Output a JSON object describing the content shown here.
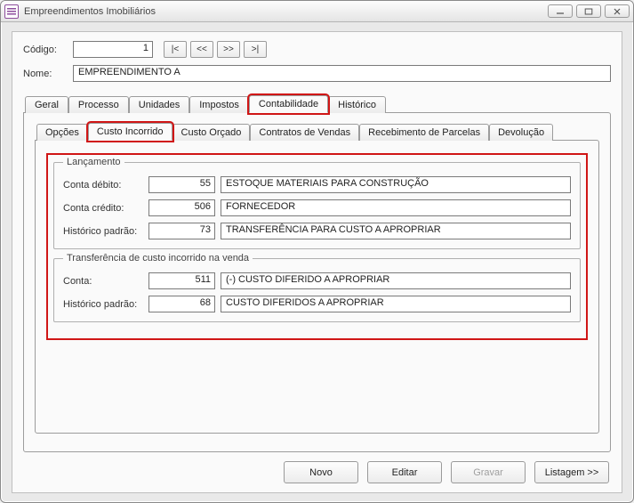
{
  "window": {
    "title": "Empreendimentos Imobiliários"
  },
  "header": {
    "codigo_label": "Código:",
    "codigo_value": "1",
    "nome_label": "Nome:",
    "nome_value": "EMPREENDIMENTO A",
    "nav": {
      "first": "|<",
      "prev": "<<",
      "next": ">>",
      "last": ">|"
    }
  },
  "tabs": {
    "geral": "Geral",
    "processo": "Processo",
    "unidades": "Unidades",
    "impostos": "Impostos",
    "contabilidade": "Contabilidade",
    "historico": "Histórico"
  },
  "subtabs": {
    "opcoes": "Opções",
    "custo_incorrido": "Custo Incorrido",
    "custo_orcado": "Custo Orçado",
    "contratos_vendas": "Contratos de Vendas",
    "recebimento_parcelas": "Recebimento de Parcelas",
    "devolucao": "Devolução"
  },
  "lancamento": {
    "legend": "Lançamento",
    "conta_debito_label": "Conta débito:",
    "conta_debito_code": "55",
    "conta_debito_desc": "ESTOQUE MATERIAIS PARA CONSTRUÇÃO",
    "conta_credito_label": "Conta crédito:",
    "conta_credito_code": "506",
    "conta_credito_desc": "FORNECEDOR",
    "historico_label": "Histórico padrão:",
    "historico_code": "73",
    "historico_desc": "TRANSFERÊNCIA PARA CUSTO A APROPRIAR"
  },
  "transferencia": {
    "legend": "Transferência de custo incorrido na venda",
    "conta_label": "Conta:",
    "conta_code": "511",
    "conta_desc": "(-) CUSTO DIFERIDO A APROPRIAR",
    "historico_label": "Histórico padrão:",
    "historico_code": "68",
    "historico_desc": "CUSTO DIFERIDOS A APROPRIAR"
  },
  "footer": {
    "novo": "Novo",
    "editar": "Editar",
    "gravar": "Gravar",
    "listagem": "Listagem >>"
  }
}
